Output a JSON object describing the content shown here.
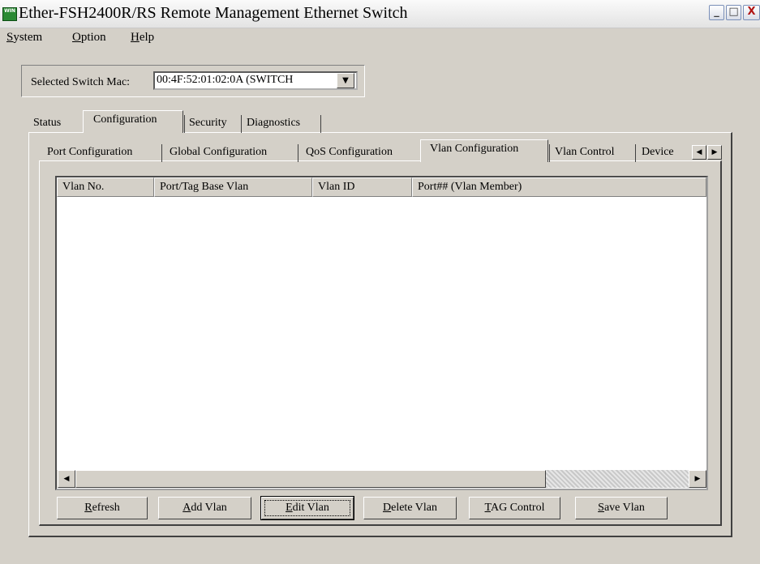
{
  "window": {
    "icon_text": "WIN",
    "title": "Ether-FSH2400R/RS Remote Management Ethernet Switch",
    "minimize": "_",
    "maximize": "□",
    "close": "X"
  },
  "menu": [
    {
      "label": "System",
      "mnemonic": "S",
      "rest": "ystem"
    },
    {
      "label": "Option",
      "mnemonic": "O",
      "rest": "ption"
    },
    {
      "label": "Help",
      "mnemonic": "H",
      "rest": "elp"
    }
  ],
  "switch_selector": {
    "label": "Selected Switch Mac:",
    "value": "00:4F:52:01:02:0A (SWITCH",
    "dropdown_icon": "chevron-down"
  },
  "main_tabs": [
    "Status",
    "Configuration",
    "Security",
    "Diagnostics"
  ],
  "main_tab_active": "Configuration",
  "sub_tabs": [
    "Port Configuration",
    "Global Configuration",
    "QoS Configuration",
    "Vlan Configuration",
    "Vlan Control",
    "Device"
  ],
  "sub_tab_active": "Vlan Configuration",
  "table": {
    "columns": [
      "Vlan No.",
      "Port/Tag Base Vlan",
      "Vlan ID",
      "Port## (Vlan Member)"
    ],
    "rows": []
  },
  "buttons": {
    "refresh": {
      "mn": "R",
      "rest": "efresh"
    },
    "add_vlan": {
      "mn": "A",
      "rest": "dd Vlan"
    },
    "edit_vlan": {
      "mn": "E",
      "rest": "dit Vlan"
    },
    "delete_vlan": {
      "mn": "D",
      "rest": "elete Vlan"
    },
    "tag_control": {
      "mn": "T",
      "rest": "AG Control"
    },
    "save_vlan": {
      "mn": "S",
      "rest": "ave Vlan"
    }
  },
  "colors": {
    "window_bg": "#d4d0c8",
    "list_bg": "#ffffff"
  }
}
